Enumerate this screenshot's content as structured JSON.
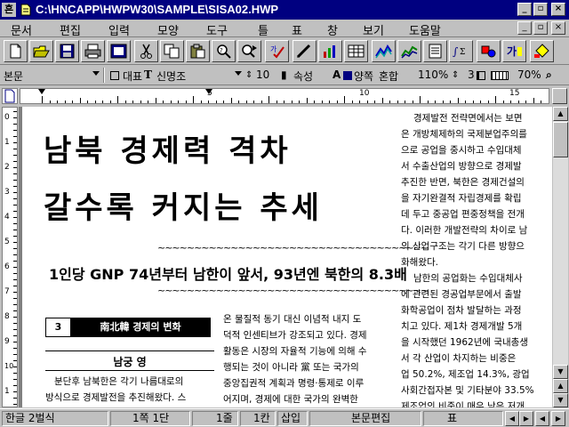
{
  "window": {
    "title": "C:\\HNCAPP\\HWPW30\\SAMPLE\\SISA02.HWP",
    "app_icon_glyph": "흔",
    "controls": [
      "_",
      "▫",
      "×"
    ]
  },
  "menu": {
    "items": [
      "문서",
      "편집",
      "입력",
      "모양",
      "도구",
      "틀",
      "표",
      "창",
      "보기",
      "도움말"
    ],
    "doc_controls": [
      "_",
      "▫",
      "×"
    ]
  },
  "toolbar": {
    "icons": [
      "new-doc-icon",
      "open-folder-icon",
      "save-icon",
      "print-icon",
      "preview-icon",
      "cut-icon",
      "copy-icon",
      "paste-icon",
      "search-icon",
      "find-replace-icon",
      "spell-check-icon",
      "draw-icon",
      "chart-icon",
      "table-icon",
      "equation-icon",
      "shape-icon",
      "font-icon",
      "paint-icon"
    ]
  },
  "formatbar": {
    "style": "본문",
    "font_lang": "대표",
    "font_name": "신명조",
    "font_size": "10",
    "attr_label": "속성",
    "align": "양쪽",
    "align2": "혼합",
    "line_spacing": "110%",
    "line_count": "3",
    "zoom": "70%"
  },
  "ruler": {
    "labels": [
      "5",
      "10",
      "15"
    ]
  },
  "vruler": {
    "labels": [
      "0",
      "1",
      "2",
      "3",
      "4",
      "5",
      "6",
      "7",
      "8",
      "9",
      "10",
      "1"
    ]
  },
  "document": {
    "headline_line1": "남북 경제력 격차",
    "headline_line2": "갈수록 커지는 추세",
    "wavy": "~~~~~~~~~~~~~~~~~~~~~~~~~~~~~~~~~~~~~",
    "subhead": "1인당 GNP 74년부터 남한이 앞서, 93년엔 북한의 8.3배",
    "section_num": "3",
    "section_label": "南北韓 경제의 변화",
    "author": "남궁 영",
    "left_col": [
      "분단후 남북한은 각기 나름대로의",
      "방식으로 경제발전을 추진해왔다. 스"
    ],
    "mid_col": [
      "온 물질적 동기 대신 이념적 내지 도",
      "덕적 인센티브가 강조되고 있다. 경제",
      "활동은 시장의 자율적 기능에 의해 수",
      "행되는 것이 아니라 黨 또는 국가의",
      "중앙집권적 계획과 명령·통제로 이루",
      "어지며, 경제에 대한 국가의 완벽한"
    ],
    "right_col": [
      "경제발전 전략면에서는 보면",
      "은 개방체제하의 국제분업주의를",
      "으로 공업을 중시하고 수입대체",
      "서 수출산업의 방향으로 경제발",
      "추진한 반면, 북한은 경제건설의",
      "을 자기완결적 자립경제를 확립",
      "데 두고 중공업 편중정책을 전개",
      "다. 이러한 개발전략의 차이로 남",
      "의 산업구조는 각기 다른 방향으",
      "화해왔다.",
      "남한의 공업화는 수입대체사",
      "에 관련된 경공업부문에서 출발",
      "화학공업이 점차 발달하는 과정",
      "치고 있다. 제1차 경제개발 5개",
      "을 시작했던 1962년에 국내총생",
      "서 각 산업이 차지하는 비중은",
      "업 50.2%, 제조업 14.3%, 광업",
      "사회간접자본 및 기타분야 33.5%",
      "제조업의 비중이 매우 낮은 저개"
    ]
  },
  "status": {
    "input_mode": "한글 2벌식",
    "page": "1쪽 1단",
    "line": "1줄",
    "col": "1칸",
    "insert": "삽입",
    "mode": "본문편집",
    "table": "표"
  }
}
